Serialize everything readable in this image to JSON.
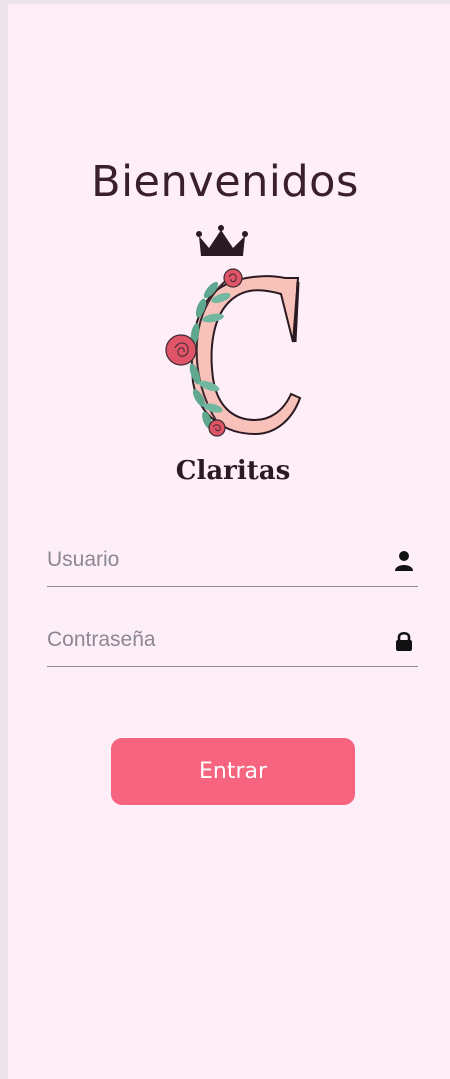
{
  "page": {
    "title": "Bienvenidos"
  },
  "logo": {
    "brand_name": "Claritas",
    "icons": [
      "crown-icon",
      "floral-letter-c-icon"
    ]
  },
  "form": {
    "username": {
      "placeholder": "Usuario",
      "value": "",
      "icon": "user-icon"
    },
    "password": {
      "placeholder": "Contraseña",
      "value": "",
      "icon": "lock-icon"
    },
    "submit_label": "Entrar"
  },
  "colors": {
    "background": "#fdeef8",
    "button": "#f7647f",
    "button_text": "#ffffff",
    "title_text": "#3a1f2e",
    "underline": "#8f8a94"
  }
}
